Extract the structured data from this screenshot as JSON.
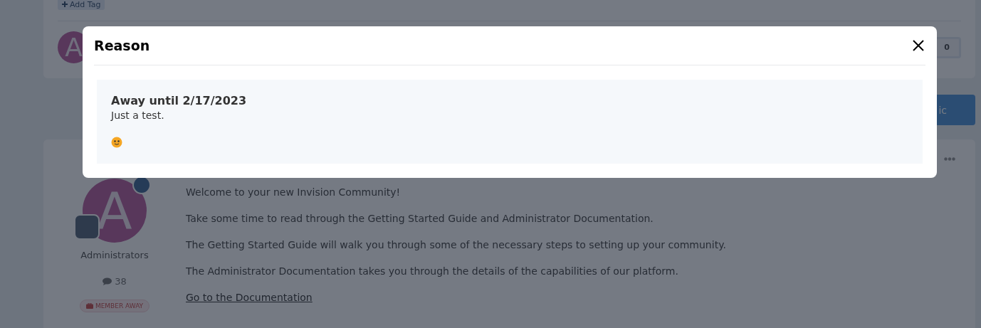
{
  "page": {
    "add_tag": "Add Tag",
    "avatar_letter": "A",
    "post_avatar_letter": "A",
    "vote_count": "0",
    "topic_button": "ic",
    "post": {
      "group": "Administrators",
      "post_count": "38",
      "away_badge": "MEMBER AWAY",
      "paragraphs": [
        "Welcome to your new Invision Community!",
        "Take some time to read through the Getting Started Guide and Administrator Documentation.",
        "The Getting Started Guide will walk you through some of the necessary steps to setting up your community.",
        "The Administrator Documentation takes you through the details of the capabilities of our platform."
      ],
      "link": "Go to the Documentation"
    }
  },
  "modal": {
    "title": "Reason",
    "heading": "Away until 2/17/2023",
    "message": "Just a test."
  }
}
